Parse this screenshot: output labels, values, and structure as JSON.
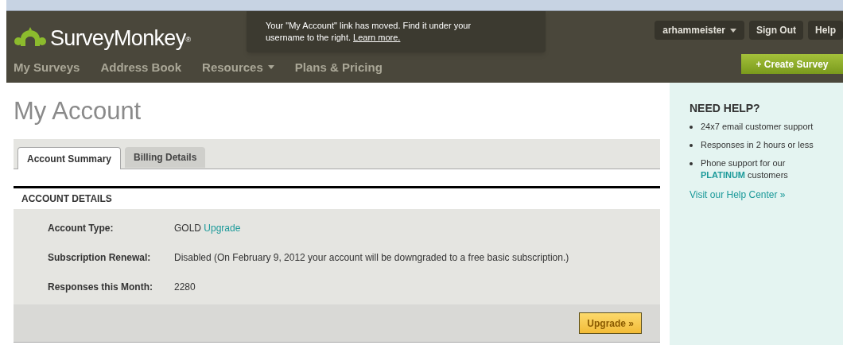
{
  "header": {
    "logo": {
      "name": "SurveyMonkey",
      "mark": "®"
    },
    "notice": {
      "text": "Your \"My Account\" link has moved. Find it under your username to the right.",
      "link": "Learn more."
    },
    "user_menu": {
      "username": "arhammeister",
      "buttons": [
        "Sign Out",
        "Help"
      ]
    },
    "nav": [
      {
        "label": "My Surveys",
        "dropdown": false
      },
      {
        "label": "Address Book",
        "dropdown": false
      },
      {
        "label": "Resources",
        "dropdown": true
      },
      {
        "label": "Plans & Pricing",
        "dropdown": false
      }
    ],
    "create_button": "+ Create Survey"
  },
  "page": {
    "title": "My Account",
    "tabs": [
      {
        "label": "Account Summary",
        "selected": true
      },
      {
        "label": "Billing Details",
        "selected": false
      }
    ],
    "section_title": "ACCOUNT DETAILS",
    "rows": [
      {
        "label": "Account Type:",
        "value": "GOLD",
        "link": "Upgrade"
      },
      {
        "label": "Subscription Renewal:",
        "value": "Disabled (On February 9, 2012 your account will be downgraded to a free basic subscription.)"
      },
      {
        "label": "Responses this Month:",
        "value": "2280"
      }
    ],
    "upgrade_button": "Upgrade »"
  },
  "help": {
    "title": "NEED HELP?",
    "items": [
      "24x7 email customer support",
      "Responses in 2 hours or less",
      "Phone support for our **PLATINUM** customers"
    ],
    "link": "Visit our Help Center »"
  }
}
